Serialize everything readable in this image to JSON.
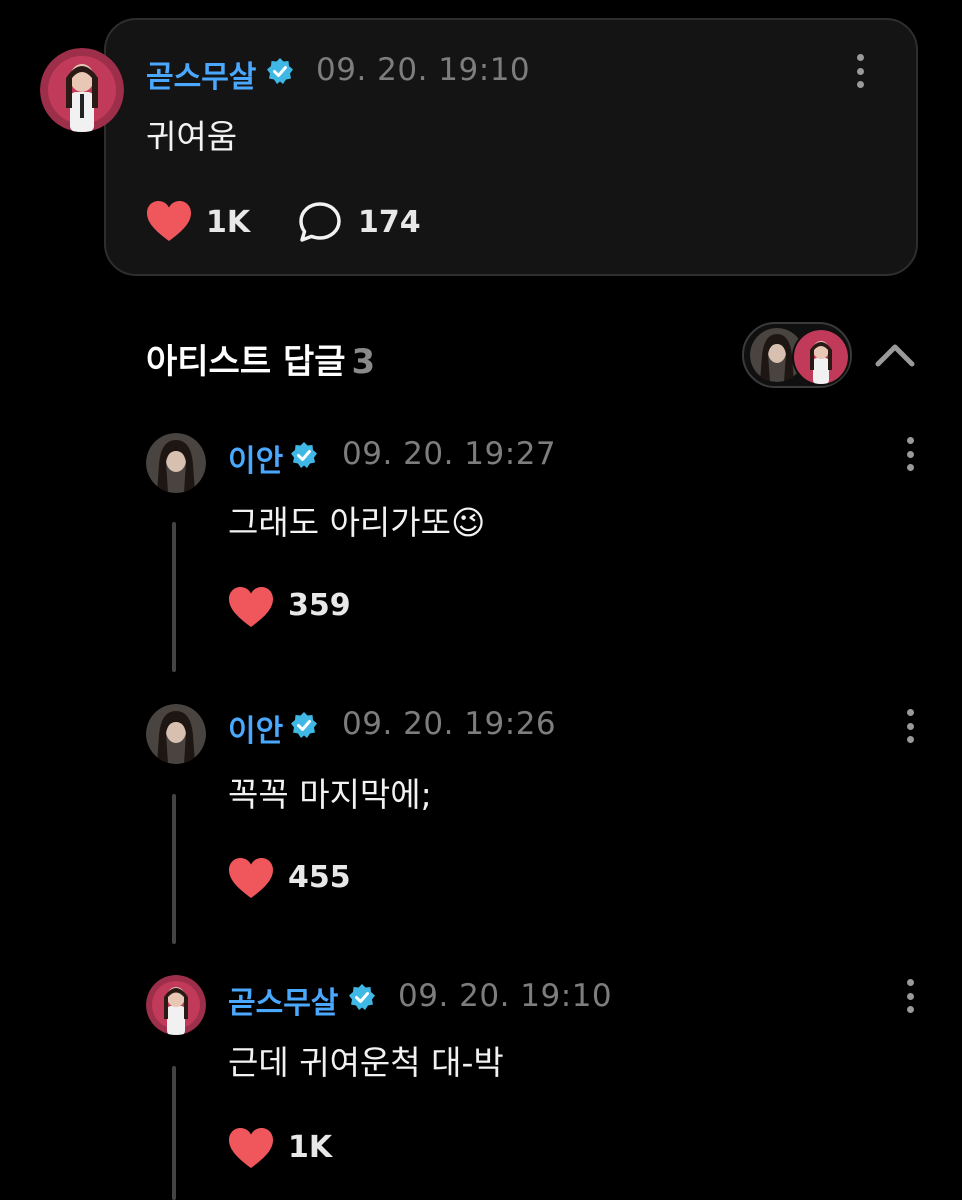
{
  "post": {
    "author": "곧스무살",
    "time": "09. 20. 19:10",
    "text": "귀여움",
    "likes": "1K",
    "comments": "174"
  },
  "artist_replies": {
    "title": "아티스트 답글",
    "count": "3",
    "replies": [
      {
        "author": "이안",
        "time": "09. 20. 19:27",
        "text": "그래도 아리가또",
        "emoji": "😉",
        "likes": "359"
      },
      {
        "author": "이안",
        "time": "09. 20. 19:26",
        "text": "꼭꼭 마지막에;",
        "likes": "455"
      },
      {
        "author": "곧스무살",
        "time": "09. 20. 19:10",
        "text": "근데 귀여운척 대-박",
        "likes": "1K"
      }
    ]
  },
  "colors": {
    "background": "#000000",
    "card": "#141414",
    "author_name": "#4aa8ff",
    "verified_badge": "#3fb8e6",
    "heart": "#f0575c",
    "timestamp": "#7d7d7d"
  },
  "icons": [
    "verified-badge-icon",
    "heart-icon",
    "comment-bubble-icon",
    "kebab-menu-icon",
    "chevron-up-icon"
  ]
}
